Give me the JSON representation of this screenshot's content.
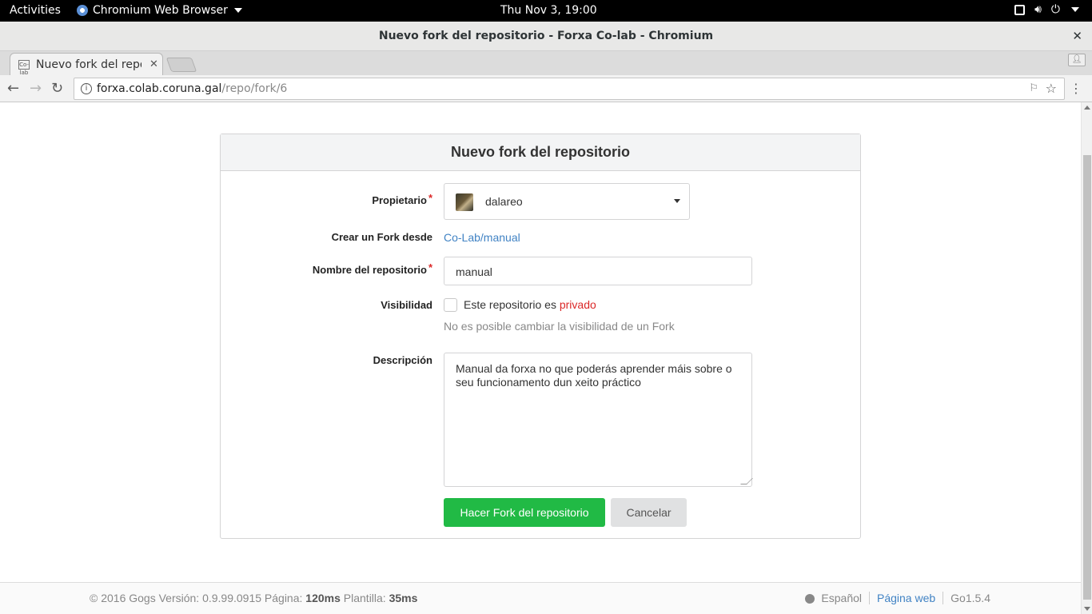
{
  "system_bar": {
    "activities": "Activities",
    "app_name": "Chromium Web Browser",
    "clock": "Thu Nov  3, 19:00"
  },
  "window": {
    "title": "Nuevo fork del repositorio - Forxa Co-lab - Chromium",
    "close_glyph": "✕"
  },
  "tab": {
    "favicon": "Co-lab",
    "title": "Nuevo fork del repositorio - Forxa Co-lab",
    "close_glyph": "✕"
  },
  "toolbar": {
    "back_glyph": "←",
    "forward_glyph": "→",
    "reload_glyph": "↻",
    "info_glyph": "i",
    "url_host": "forxa.colab.coruna.gal",
    "url_path": "/repo/fork/6",
    "translate_glyph": "⚐",
    "star_glyph": "☆",
    "menu_glyph": "⋮"
  },
  "form": {
    "header": "Nuevo fork del repositorio",
    "owner_label": "Propietario",
    "owner_value": "dalareo",
    "fork_from_label": "Crear un Fork desde",
    "fork_from_link": "Co-Lab/manual",
    "repo_name_label": "Nombre del repositorio",
    "repo_name_value": "manual",
    "visibility_label": "Visibilidad",
    "private_text": "Este repositorio es ",
    "private_word": "privado",
    "visibility_help": "No es posible cambiar la visibilidad de un Fork",
    "description_label": "Descripción",
    "description_value": "Manual da forxa no que poderás aprender máis sobre o seu funcionamento dun xeito práctico",
    "required_mark": "*",
    "submit_label": "Hacer Fork del repositorio",
    "cancel_label": "Cancelar"
  },
  "footer": {
    "copyright": "© 2016 Gogs Versión: 0.9.99.0915 Página: ",
    "page_time": "120ms",
    "template_label": " Plantilla: ",
    "template_time": "35ms",
    "language": "Español",
    "website": "Página web",
    "go_version": "Go1.5.4"
  },
  "colors": {
    "accent_green": "#21ba45",
    "link_blue": "#4183c4",
    "required_red": "#db2828"
  }
}
